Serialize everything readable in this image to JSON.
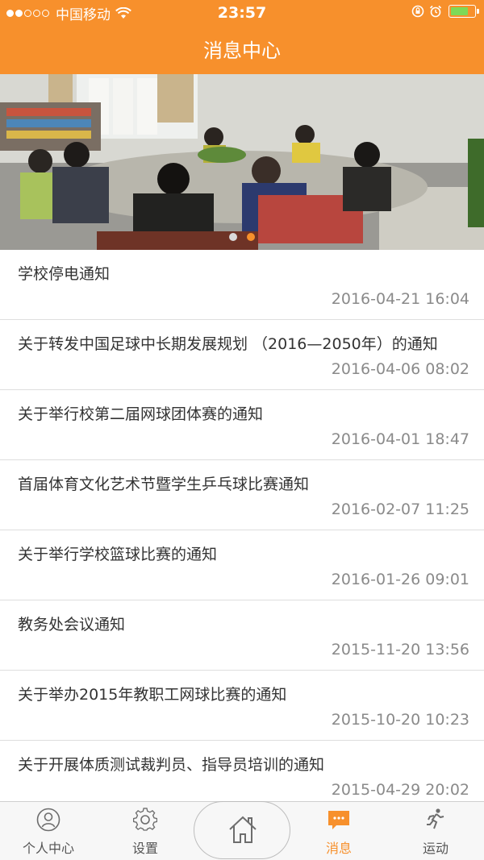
{
  "status_bar": {
    "carrier": "中国移动",
    "time": "23:57"
  },
  "header": {
    "title": "消息中心"
  },
  "banner": {
    "page_count": 2,
    "active_page": 2
  },
  "messages": [
    {
      "title": "学校停电通知",
      "date": "2016-04-21 16:04"
    },
    {
      "title": "关于转发中国足球中长期发展规划 （2016—2050年）的通知",
      "date": "2016-04-06 08:02"
    },
    {
      "title": "关于举行校第二届网球团体赛的通知",
      "date": "2016-04-01 18:47"
    },
    {
      "title": "首届体育文化艺术节暨学生乒乓球比赛通知",
      "date": "2016-02-07 11:25"
    },
    {
      "title": "关于举行学校篮球比赛的通知",
      "date": "2016-01-26 09:01"
    },
    {
      "title": "教务处会议通知",
      "date": "2015-11-20 13:56"
    },
    {
      "title": "关于举办2015年教职工网球比赛的通知",
      "date": "2015-10-20 10:23"
    },
    {
      "title": "关于开展体质测试裁判员、指导员培训的通知",
      "date": "2015-04-29 20:02"
    }
  ],
  "tabbar": {
    "tabs": [
      {
        "label": "个人中心",
        "icon": "person-icon"
      },
      {
        "label": "设置",
        "icon": "gear-icon"
      },
      {
        "label": "",
        "icon": "home-icon"
      },
      {
        "label": "消息",
        "icon": "message-icon"
      },
      {
        "label": "运动",
        "icon": "running-icon"
      }
    ],
    "active_index": 3
  },
  "colors": {
    "accent": "#f7902c",
    "battery": "#7ed957"
  }
}
